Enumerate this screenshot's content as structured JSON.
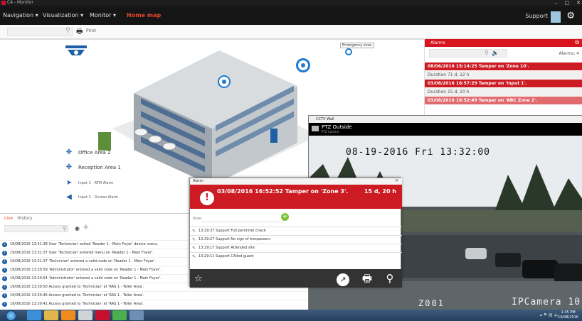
{
  "window": {
    "title": "C4 - Monitor",
    "controls": [
      "–",
      "□",
      "✕"
    ]
  },
  "menubar": {
    "items": [
      {
        "label": "Navigation ▾",
        "active": false
      },
      {
        "label": "Visualization ▾",
        "active": false
      },
      {
        "label": "Monitor ▾",
        "active": false
      },
      {
        "label": "Home map",
        "active": true
      }
    ],
    "support_label": "Support"
  },
  "toolbar": {
    "print_label": "Print"
  },
  "map": {
    "emergency_label": "Emergency evac",
    "zones": [
      {
        "label": "Office Area 2",
        "icon": "zone-icon"
      },
      {
        "label": "Reception Area 1",
        "icon": "zone-icon"
      },
      {
        "label": "Input 1 - ATM Alarm",
        "icon": "input-icon"
      },
      {
        "label": "Input 2 - Duress Alarm",
        "icon": "duress-icon"
      }
    ]
  },
  "alarms_panel": {
    "title": "Alarms",
    "count": "Alarms: 4",
    "rows": [
      {
        "text": "08/06/2016 15:14:25 Tamper on 'Zone 10'.",
        "style": "red"
      },
      {
        "text": "Duration 71 d, 22 h",
        "style": "grey"
      },
      {
        "text": "03/08/2016 16:57:29 Tamper on 'Input 1'.",
        "style": "red"
      },
      {
        "text": "Duration 15 d, 20 h",
        "style": "grey"
      },
      {
        "text": "03/08/2016 16:52:49 Tamper on 'ABC Zone 2'.",
        "style": "pink"
      }
    ]
  },
  "log": {
    "tabs": [
      "Live",
      "History"
    ],
    "rows": [
      "19/08/2016 13:31:38 User 'Technician' exited 'Reader 1 - Main Foyer' device menu.",
      "19/08/2016 13:31:37 User 'Technician' entered menu on 'Reader 1 - Main Foyer'.",
      "19/08/2016 13:31:37 'Technician' entered a valid code on 'Reader 1 - Main Foyer'.",
      "19/08/2016 13:30:59 'Administrator' entered a valid code on 'Reader 1 - Main Foyer'.",
      "19/08/2016 13:30:54 'Administrator' entered a valid code on 'Reader 1 - Main Foyer'.",
      "19/08/2016 13:30:50 Access granted to 'Technician' at 'RAS 1 - Teller Area'.",
      "19/08/2016 13:30:46 Access granted to 'Technician' at 'RAS 1 - Teller Area'.",
      "19/08/2016 13:30:41 Access granted to 'Technician' at 'RAS 1 - Teller Area'."
    ]
  },
  "cctv": {
    "window_title": "CCTV Wall",
    "tab_label": "PTZ Outside",
    "tab_sub": "PTZ Camera",
    "timestamp": "08-19-2016 Fri 13:32:00",
    "zone": "Z001",
    "camera_name": "IPCamera 10"
  },
  "popup": {
    "window_title": "Alarm",
    "alarm_text": "03/08/2016 16:52:52 Tamper on 'Zone 3'.",
    "duration": "15 d, 20 h",
    "note_label": "Note:",
    "rows": [
      "13:29:37 Support Full perimiter check",
      "13:29:27 Support No sign of trespassers",
      "13:29:17 Support Attended site",
      "13:29:11 Support CAlled guard"
    ]
  },
  "taskbar": {
    "time": "1:35 PM",
    "date": "19/08/2016"
  },
  "colors": {
    "accent": "#e8452c",
    "alarm_red": "#cc1b22",
    "brand_blue": "#1e5fa8"
  }
}
